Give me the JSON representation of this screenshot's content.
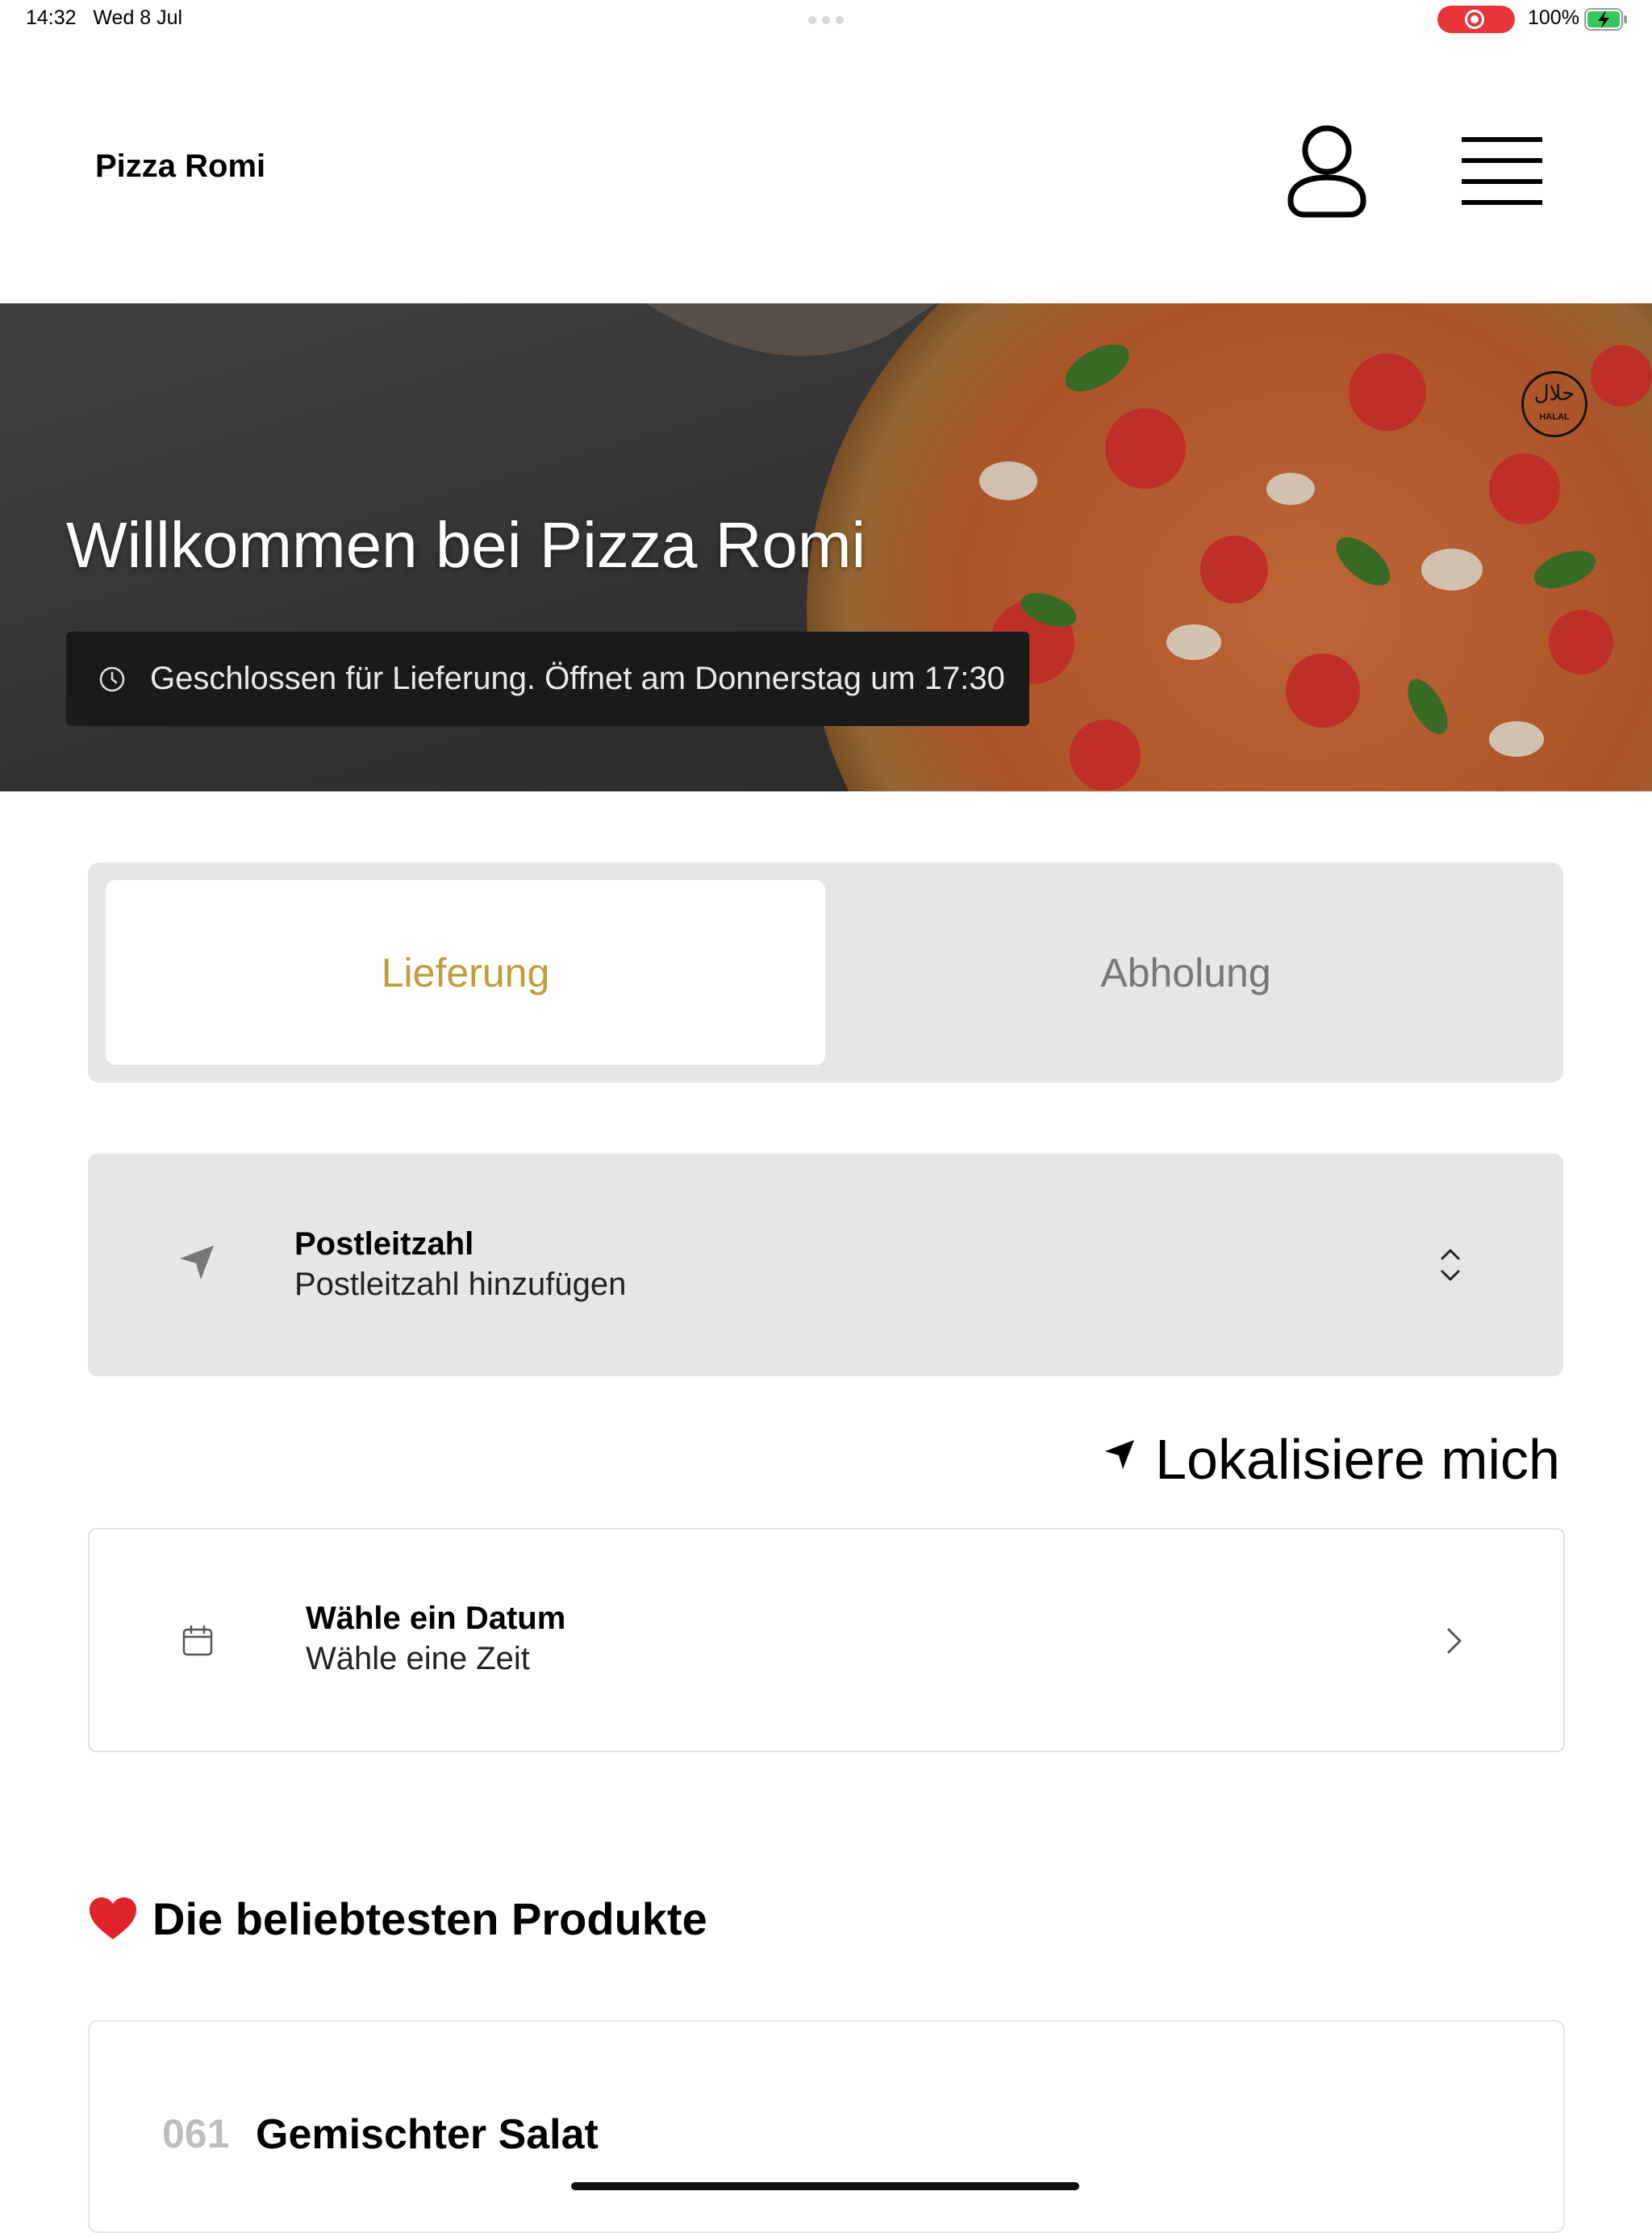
{
  "status_bar": {
    "time": "14:32",
    "date": "Wed 8 Jul",
    "battery": "100%",
    "recording_color": "#e8353a"
  },
  "header": {
    "title": "Pizza Romi",
    "account_icon": "person-icon",
    "menu_icon": "hamburger-menu-icon"
  },
  "hero": {
    "title": "Willkommen bei Pizza Romi",
    "status": "Geschlossen für Lieferung. Öffnet am Donnerstag um 17:30",
    "badge_arabic": "حلال",
    "badge_text": "HALAL"
  },
  "mode_toggle": {
    "tabs": [
      {
        "label": "Lieferung",
        "selected": true
      },
      {
        "label": "Abholung",
        "selected": false
      }
    ],
    "accent_color": "#bf9d3a"
  },
  "postal": {
    "label": "Postleitzahl",
    "value": "Postleitzahl hinzufügen"
  },
  "locate": {
    "label": "Lokalisiere mich"
  },
  "schedule": {
    "date_label": "Wähle ein Datum",
    "time_label": "Wähle eine Zeit"
  },
  "popular": {
    "heading": "Die beliebtesten Produkte",
    "products": [
      {
        "number": "061",
        "name": "Gemischter Salat"
      }
    ]
  }
}
